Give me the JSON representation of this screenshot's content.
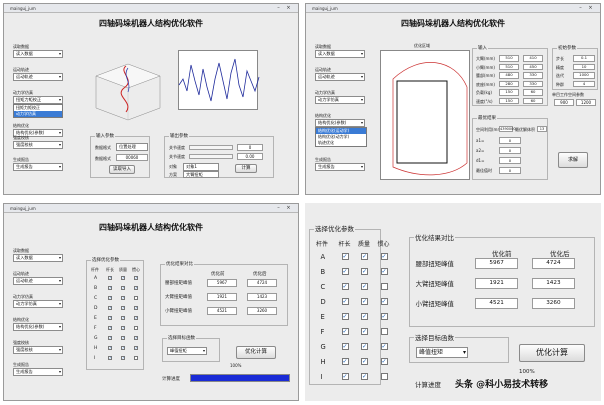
{
  "app_title": "四轴码垛机器人结构优化软件",
  "tb_title": "mainguj_jum",
  "controls": {
    "label1": "读取数据",
    "label2": "运动轨迹",
    "label3": "动力学仿真",
    "label4": "结构优化",
    "label5": "强度校核",
    "label6": "生成报告",
    "v1": "读入数据",
    "v2": "运动轨迹",
    "v3": "动力学仿真",
    "v4": "结构优化(参数)",
    "v5": "强度校核",
    "v6": "生成报告"
  },
  "q1": {
    "dd3_open": [
      "扭矩力矩校正",
      "扭矩力矩校正",
      "动力学仿真"
    ],
    "input_group": "输入参数",
    "file_label": "数据格式",
    "file_value": "位置处理",
    "file_value2": "00060",
    "import_btn": "读取导入",
    "out_group": "输出参数",
    "out1": "关节速度",
    "out2": "关节速度",
    "val1": "0",
    "val2": "0.00",
    "btn3": "计算",
    "sub1": "对象",
    "sub2": "方案",
    "sel1": "对象1",
    "sel2": "大臂扭矩"
  },
  "q2": {
    "dd4_open": [
      "结构优化(运动学)",
      "结构优化(动力学)",
      "轨迹优化"
    ],
    "plot_title": "优化区域",
    "input_group": "输入",
    "in_rows": [
      {
        "lbl": "大臂(mm)",
        "v": "510"
      },
      {
        "lbl": "小臂(mm)",
        "v": "510"
      },
      {
        "lbl": "腰部(mm)",
        "v": "480"
      },
      {
        "lbl": "底座(mm)",
        "v": "280"
      },
      {
        "lbl": "负载(kg)",
        "v": "150"
      },
      {
        "lbl": "速度(°/s)",
        "v": "150"
      }
    ],
    "in_r": [
      "410",
      "450",
      "330",
      "330",
      "60",
      "60"
    ],
    "opt_group": "初始参数",
    "opt_rows": [
      {
        "lbl": "步长",
        "v": "0.1"
      },
      {
        "lbl": "精度",
        "v": "10"
      },
      {
        "lbl": "迭代",
        "v": "1000"
      },
      {
        "lbl": "种群",
        "v": "4"
      }
    ],
    "work_title": "单目工作空间参数",
    "work_vals": [
      "900",
      "1200"
    ],
    "result_group": "最优结果",
    "res_label": "空间利用(mm)",
    "res_label2": "最优解体积",
    "res_v1": "4390000",
    "res_v2": "13",
    "res_rows": [
      {
        "lbl": "a1=",
        "v": "0"
      },
      {
        "lbl": "a2=",
        "v": "0"
      },
      {
        "lbl": "d1=",
        "v": "0"
      },
      {
        "lbl": "最佳值时",
        "v": "0"
      }
    ],
    "solve_btn": "求解"
  },
  "q3": {
    "sel_group": "选择优化参数",
    "cols": [
      "杆件",
      "杆长",
      "质量",
      "惯心"
    ],
    "rows": [
      "A",
      "B",
      "C",
      "D",
      "E",
      "F",
      "G",
      "H",
      "I"
    ],
    "result_group": "优化结果对比",
    "col_before": "优化前",
    "col_after": "优化后",
    "results": [
      {
        "lbl": "腰部扭矩峰值",
        "before": "5967",
        "after": "4724"
      },
      {
        "lbl": "大臂扭矩峰值",
        "before": "1921",
        "after": "1423"
      },
      {
        "lbl": "小臂扭矩峰值",
        "before": "4521",
        "after": "3260"
      }
    ],
    "obj_group": "选择目标函数",
    "obj_value": "峰值扭矩",
    "opt_btn": "优化计算",
    "progress_label": "计算进度",
    "progress_pct": "100%",
    "progress": 1.0
  },
  "q4": {
    "sel_group": "选择优化参数",
    "cols": [
      "杆件",
      "杆长",
      "质量",
      "惯心"
    ],
    "rows": [
      "A",
      "B",
      "C",
      "D",
      "E",
      "F",
      "G",
      "H",
      "I"
    ],
    "result_group": "优化结果对比",
    "col_before": "优化前",
    "col_after": "优化后",
    "results": [
      {
        "lbl": "腰部扭矩峰值",
        "before": "5967",
        "after": "4724"
      },
      {
        "lbl": "大臂扭矩峰值",
        "before": "1921",
        "after": "1423"
      },
      {
        "lbl": "小臂扭矩峰值",
        "before": "4521",
        "after": "3260"
      }
    ],
    "obj_group": "选择目标函数",
    "obj_value": "峰值扭矩",
    "opt_btn": "优化计算",
    "progress_label": "计算进度",
    "progress_pct": "100%"
  },
  "watermark": "头条 @科小易技术转移"
}
